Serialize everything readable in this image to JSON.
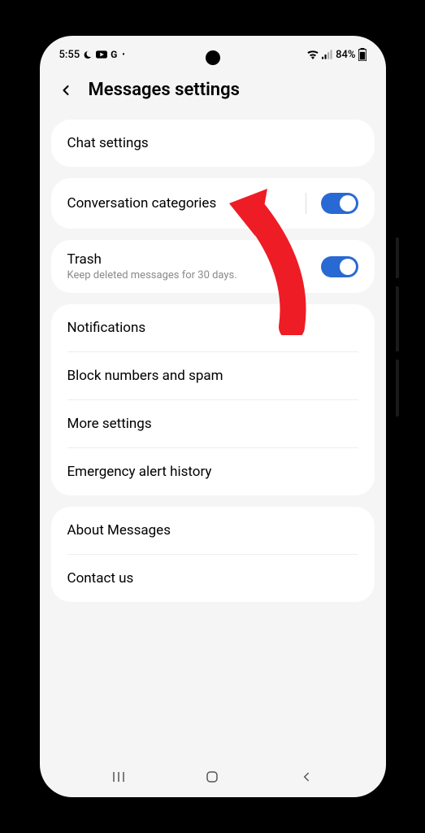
{
  "status": {
    "time": "5:55",
    "battery": "84%"
  },
  "header": {
    "title": "Messages settings"
  },
  "group1": {
    "chat_settings": "Chat settings"
  },
  "group2": {
    "conversation_categories": "Conversation categories"
  },
  "group3": {
    "trash_label": "Trash",
    "trash_sublabel": "Keep deleted messages for 30 days."
  },
  "group4": {
    "notifications": "Notifications",
    "block": "Block numbers and spam",
    "more": "More settings",
    "emergency": "Emergency alert history"
  },
  "group5": {
    "about": "About Messages",
    "contact": "Contact us"
  }
}
